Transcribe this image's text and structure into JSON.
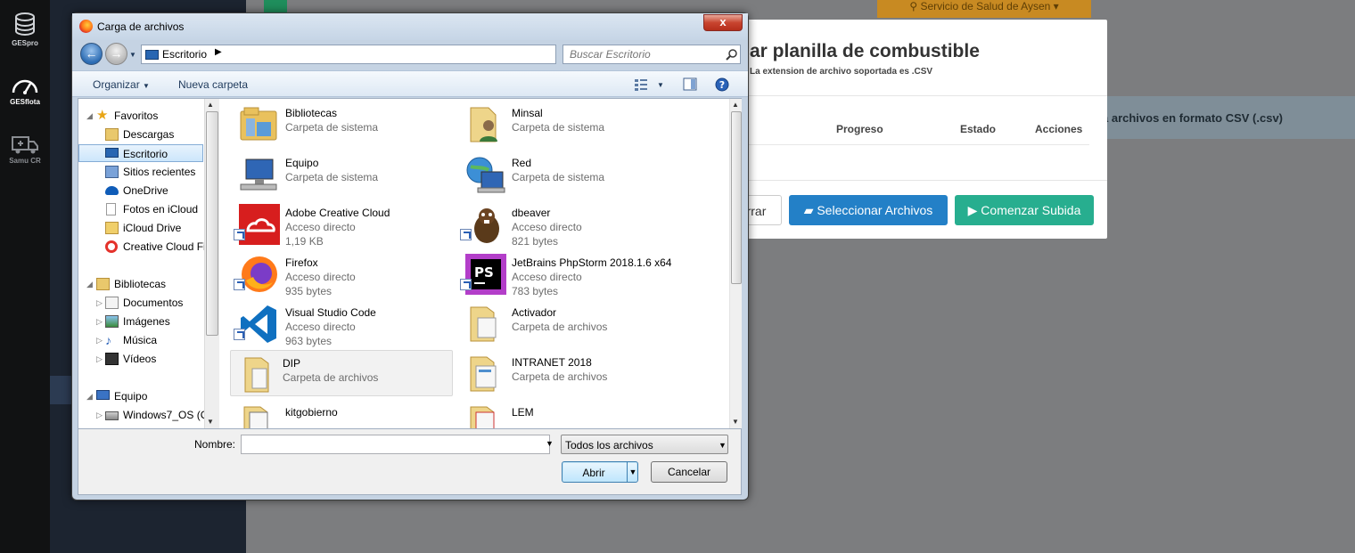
{
  "app_nav": {
    "items": [
      {
        "label": "GESpro"
      },
      {
        "label": "GESflota"
      },
      {
        "label": "Samu CR"
      }
    ]
  },
  "background": {
    "header_dropdown": "Servicio de Salud de Aysen",
    "info_strip": "a archivos en formato CSV (.csv)",
    "modal": {
      "title": "ar planilla de combustible",
      "subtitle": "La extension de archivo soportada es .CSV",
      "columns": [
        "Progreso",
        "Estado",
        "Acciones"
      ],
      "clear_button": "rrar",
      "select_button": "Seleccionar Archivos",
      "start_button": "Comenzar Subida"
    }
  },
  "dialog": {
    "title": "Carga de archivos",
    "close_label": "x",
    "address": "Escritorio",
    "search_placeholder": "Buscar Escritorio",
    "toolbar": {
      "organize": "Organizar",
      "new_folder": "Nueva carpeta"
    },
    "nav_tree": [
      {
        "label": "Favoritos",
        "icon": "star-icon"
      },
      {
        "label": "Descargas",
        "icon": "downloads-icon"
      },
      {
        "label": "Escritorio",
        "icon": "desktop-icon",
        "selected": true
      },
      {
        "label": "Sitios recientes",
        "icon": "recent-icon"
      },
      {
        "label": "OneDrive",
        "icon": "onedrive-icon"
      },
      {
        "label": "Fotos en iCloud",
        "icon": "icloud-photos-icon"
      },
      {
        "label": "iCloud Drive",
        "icon": "icloud-drive-icon"
      },
      {
        "label": "Creative Cloud Fi",
        "icon": "creative-cloud-icon"
      },
      {
        "label": "Bibliotecas",
        "icon": "libraries-icon"
      },
      {
        "label": "Documentos",
        "icon": "documents-icon"
      },
      {
        "label": "Imágenes",
        "icon": "images-icon"
      },
      {
        "label": "Música",
        "icon": "music-icon"
      },
      {
        "label": "Vídeos",
        "icon": "videos-icon"
      },
      {
        "label": "Equipo",
        "icon": "computer-icon"
      },
      {
        "label": "Windows7_OS (C",
        "icon": "drive-icon"
      }
    ],
    "files": [
      {
        "name": "Bibliotecas",
        "type": "Carpeta de sistema",
        "size": "",
        "icon": "libraries-icon"
      },
      {
        "name": "Minsal",
        "type": "Carpeta de sistema",
        "size": "",
        "icon": "user-folder-icon"
      },
      {
        "name": "Equipo",
        "type": "Carpeta de sistema",
        "size": "",
        "icon": "computer-icon"
      },
      {
        "name": "Red",
        "type": "Carpeta de sistema",
        "size": "",
        "icon": "network-icon"
      },
      {
        "name": "Adobe Creative Cloud",
        "type": "Acceso directo",
        "size": "1,19 KB",
        "icon": "adobe-cc-icon"
      },
      {
        "name": "dbeaver",
        "type": "Acceso directo",
        "size": "821 bytes",
        "icon": "dbeaver-icon"
      },
      {
        "name": "Firefox",
        "type": "Acceso directo",
        "size": "935 bytes",
        "icon": "firefox-icon"
      },
      {
        "name": "JetBrains PhpStorm 2018.1.6 x64",
        "type": "Acceso directo",
        "size": "783 bytes",
        "icon": "phpstorm-icon"
      },
      {
        "name": "Visual Studio Code",
        "type": "Acceso directo",
        "size": "963 bytes",
        "icon": "vscode-icon"
      },
      {
        "name": "Activador",
        "type": "Carpeta de archivos",
        "size": "",
        "icon": "folder-icon"
      },
      {
        "name": "DIP",
        "type": "Carpeta de archivos",
        "size": "",
        "icon": "folder-icon",
        "selected": true
      },
      {
        "name": "INTRANET 2018",
        "type": "Carpeta de archivos",
        "size": "",
        "icon": "folder-icon"
      },
      {
        "name": "kitgobierno",
        "type": "",
        "size": "",
        "icon": "folder-icon"
      },
      {
        "name": "LEM",
        "type": "",
        "size": "",
        "icon": "folder-icon"
      }
    ],
    "name_label": "Nombre:",
    "name_value": "",
    "filter": "Todos los archivos",
    "open_button": "Abrir",
    "cancel_button": "Cancelar"
  }
}
